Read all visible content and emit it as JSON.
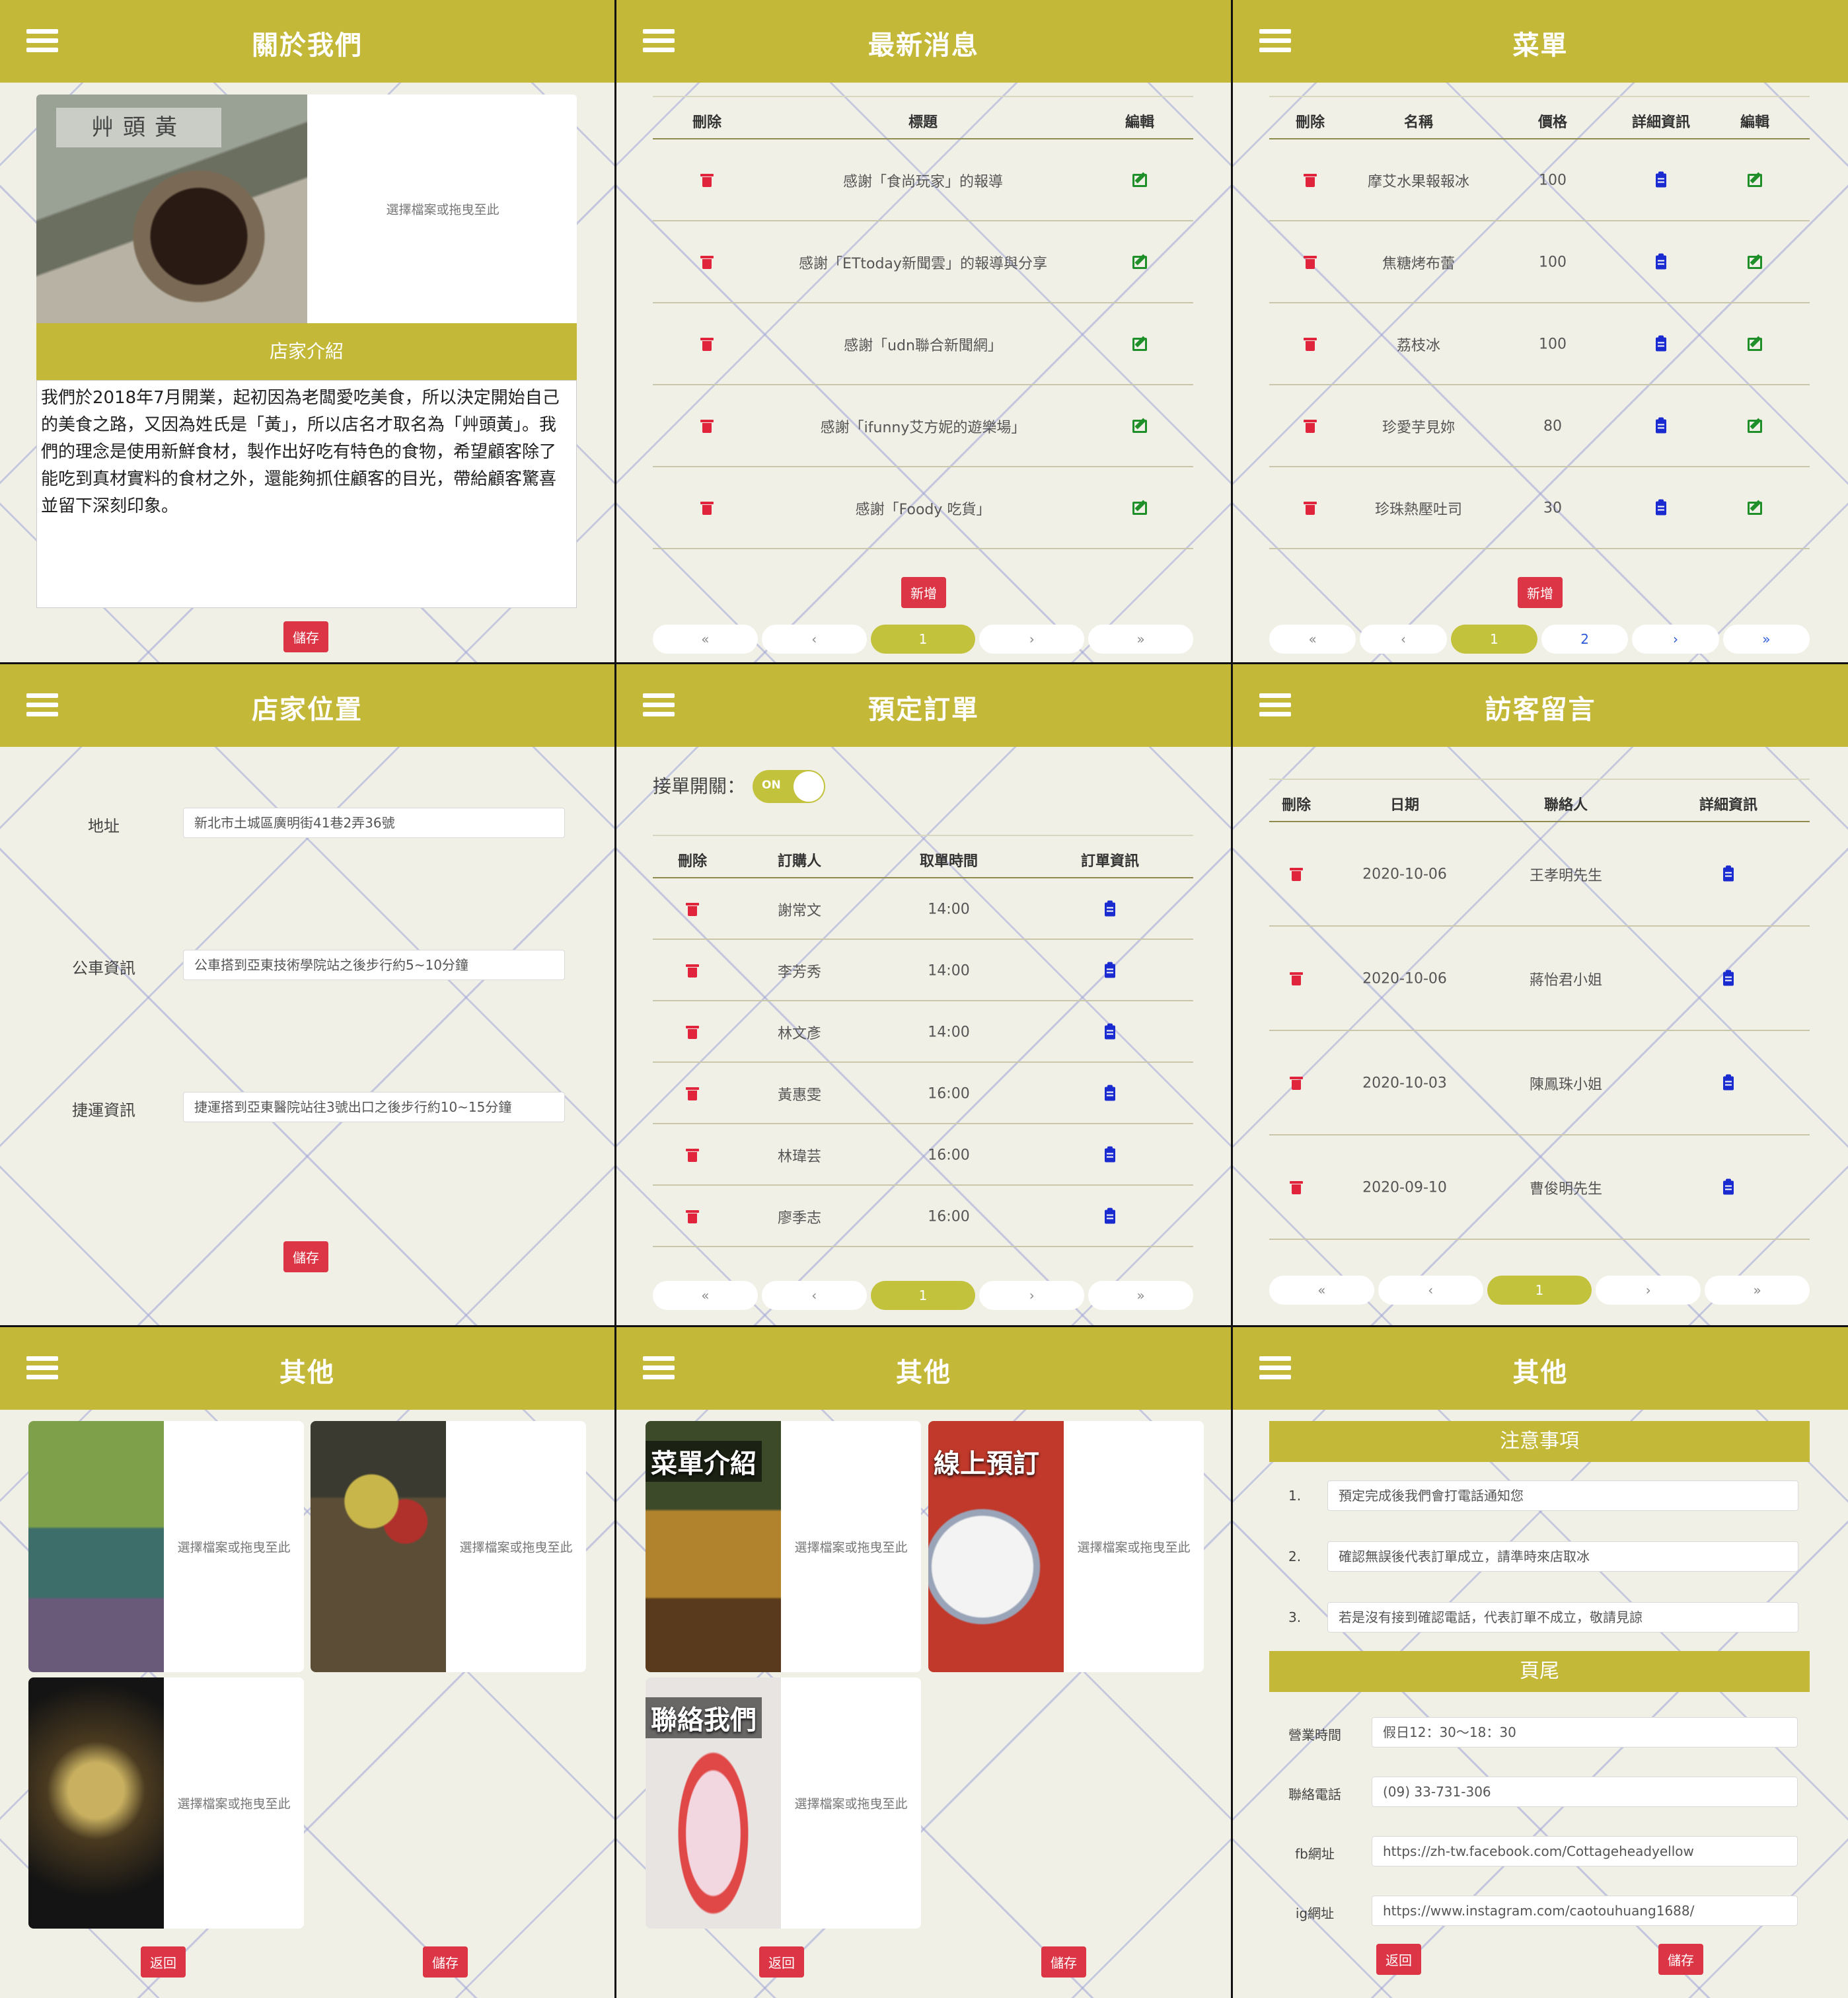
{
  "colors": {
    "header": "#c3b837",
    "danger": "#dc3545",
    "edit": "#1f8f2a",
    "info": "#1a2bd0"
  },
  "common": {
    "upload_hint": "選擇檔案或拖曳至此",
    "save": "儲存",
    "back": "返回",
    "add": "新增"
  },
  "about": {
    "title": "關於我們",
    "intro_label": "店家介紹",
    "intro_text": "我們於2018年7月開業，起初因為老闆愛吃美食，所以決定開始自己的美食之路，又因為姓氏是「黃」，所以店名才取名為「艸頭黃」。我們的理念是使用新鮮食材，製作出好吃有特色的食物，希望顧客除了能吃到真材實料的食材之外，還能夠抓住顧客的目光，帶給顧客驚喜並留下深刻印象。",
    "sign_text": "艸頭黃"
  },
  "news": {
    "title": "最新消息",
    "headers": {
      "delete": "刪除",
      "title": "標題",
      "edit": "編輯"
    },
    "rows": [
      {
        "title": "感謝「食尚玩家」的報導"
      },
      {
        "title": "感謝「ETtoday新聞雲」的報導與分享"
      },
      {
        "title": "感謝「udn聯合新聞網」"
      },
      {
        "title": "感謝「ifunny艾方妮的遊樂場」"
      },
      {
        "title": "感謝「Foody 吃貨」"
      }
    ],
    "pager": [
      "«",
      "‹",
      "1",
      "›",
      "»"
    ]
  },
  "menu": {
    "title": "菜單",
    "headers": {
      "delete": "刪除",
      "name": "名稱",
      "price": "價格",
      "detail": "詳細資訊",
      "edit": "編輯"
    },
    "rows": [
      {
        "name": "摩艾水果報報冰",
        "price": "100"
      },
      {
        "name": "焦糖烤布蕾",
        "price": "100"
      },
      {
        "name": "荔枝冰",
        "price": "100"
      },
      {
        "name": "珍愛芋見妳",
        "price": "80"
      },
      {
        "name": "珍珠熱壓吐司",
        "price": "30"
      }
    ],
    "pager": [
      "«",
      "‹",
      "1",
      "2",
      "›",
      "»"
    ]
  },
  "location": {
    "title": "店家位置",
    "fields": [
      {
        "label": "地址",
        "value": "新北市土城區廣明街41巷2弄36號"
      },
      {
        "label": "公車資訊",
        "value": "公車搭到亞東技術學院站之後步行約5~10分鐘"
      },
      {
        "label": "捷運資訊",
        "value": "捷運搭到亞東醫院站往3號出口之後步行約10~15分鐘"
      }
    ]
  },
  "orders": {
    "title": "預定訂單",
    "toggle_label": "接單開關：",
    "toggle_state": "ON",
    "headers": {
      "delete": "刪除",
      "buyer": "訂購人",
      "pickup": "取單時間",
      "info": "訂單資訊"
    },
    "rows": [
      {
        "buyer": "謝常文",
        "time": "14:00"
      },
      {
        "buyer": "李芳秀",
        "time": "14:00"
      },
      {
        "buyer": "林文彥",
        "time": "14:00"
      },
      {
        "buyer": "黃惠雯",
        "time": "16:00"
      },
      {
        "buyer": "林瑋芸",
        "time": "16:00"
      },
      {
        "buyer": "廖季志",
        "time": "16:00"
      }
    ],
    "pager": [
      "«",
      "‹",
      "1",
      "›",
      "»"
    ]
  },
  "messages": {
    "title": "訪客留言",
    "headers": {
      "delete": "刪除",
      "date": "日期",
      "contact": "聯絡人",
      "detail": "詳細資訊"
    },
    "rows": [
      {
        "date": "2020-10-06",
        "contact": "王孝明先生"
      },
      {
        "date": "2020-10-06",
        "contact": "蔣怡君小姐"
      },
      {
        "date": "2020-10-03",
        "contact": "陳鳳珠小姐"
      },
      {
        "date": "2020-09-10",
        "contact": "曹俊明先生"
      }
    ],
    "pager": [
      "«",
      "‹",
      "1",
      "›",
      "»"
    ]
  },
  "other1": {
    "title": "其他"
  },
  "other2": {
    "title": "其他",
    "cards": [
      {
        "overlay": "菜單介紹"
      },
      {
        "overlay": "線上預訂"
      },
      {
        "overlay": "聯絡我們"
      }
    ]
  },
  "other3": {
    "title": "其他",
    "notice_title": "注意事項",
    "notices": [
      {
        "num": "1.",
        "text": "預定完成後我們會打電話通知您"
      },
      {
        "num": "2.",
        "text": "確認無誤後代表訂單成立，請準時來店取冰"
      },
      {
        "num": "3.",
        "text": "若是沒有接到確認電話，代表訂單不成立，敬請見諒"
      }
    ],
    "footer_title": "頁尾",
    "footer_fields": [
      {
        "label": "營業時間",
        "value": "假日12：30～18：30"
      },
      {
        "label": "聯絡電話",
        "value": "(09) 33-731-306"
      },
      {
        "label": "fb網址",
        "value": "https://zh-tw.facebook.com/Cottageheadyellow"
      },
      {
        "label": "ig網址",
        "value": "https://www.instagram.com/caotouhuang1688/"
      }
    ]
  }
}
